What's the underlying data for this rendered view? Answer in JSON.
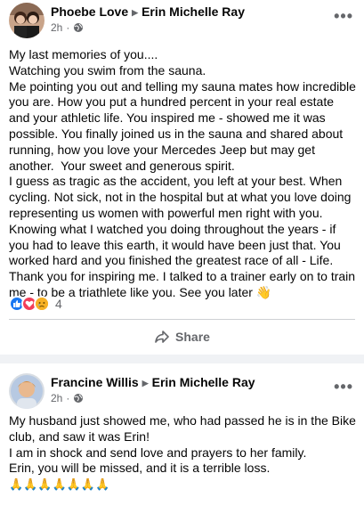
{
  "post1": {
    "author": "Phoebe Love",
    "recipient": "Erin Michelle Ray",
    "time": "2h",
    "text": "My last memories of you....\nWatching you swim from the sauna.\nMe pointing you out and telling my sauna mates how incredible you are. How you put a hundred percent in your real estate and your athletic life. You inspired me - showed me it was possible. You finally joined us in the sauna and shared about running, how you love your Mercedes Jeep but may get another.  Your sweet and generous spirit.\nI guess as tragic as the accident, you left at your best. When cycling. Not sick, not in the hospital but at what you love doing representing us women with powerful men right with you. Knowing what I watched you doing throughout the years - if you had to leave this earth, it would have been just that. You worked hard and you finished the greatest race of all - Life. Thank you for inspiring me. I talked to a trainer early on to train me - to be a triathlete like you. See you later 👋",
    "reaction_count": "4",
    "share_label": "Share"
  },
  "post2": {
    "author": "Francine Willis",
    "recipient": "Erin Michelle Ray",
    "time": "2h",
    "text": "My husband just showed me, who had passed he is in the Bike club, and saw it was Erin!\nI am in shock and send love and prayers to her family.\nErin, you will be missed, and it is a terrible loss.",
    "emoji": "🙏🙏🙏🙏🙏🙏🙏"
  },
  "icons": [
    "globe-icon",
    "more-options-icon",
    "like-icon",
    "love-icon",
    "sad-icon",
    "share-icon"
  ],
  "colors": {
    "like": "#1877f2",
    "love": "#f33e58",
    "sad": "#f7b125",
    "secondary_text": "#65676b"
  }
}
